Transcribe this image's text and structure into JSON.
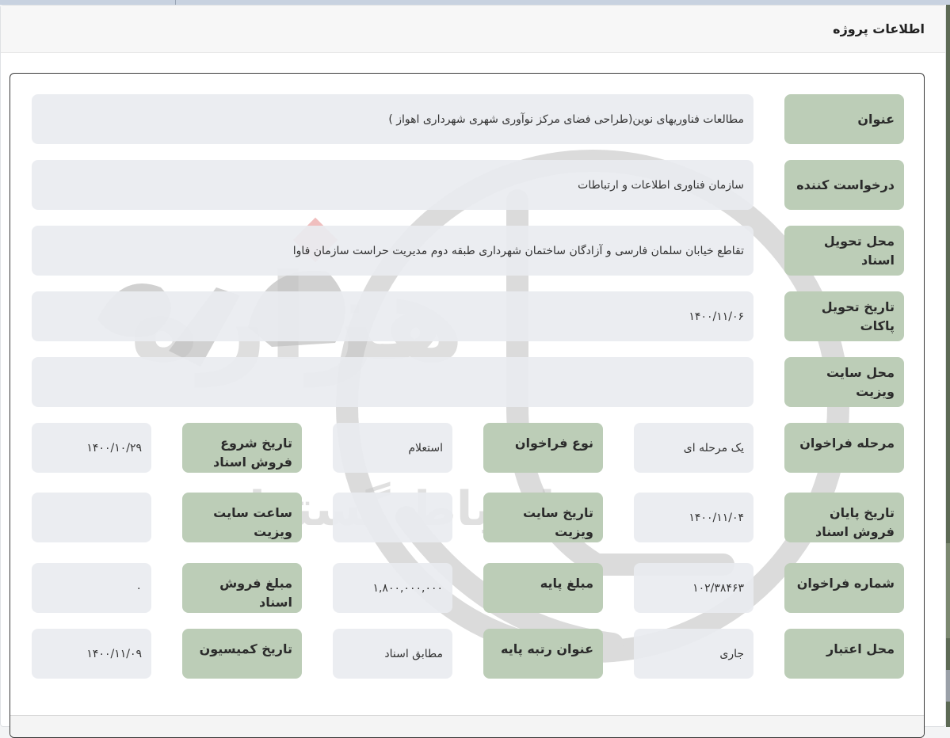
{
  "header": {
    "title": "اطلاعات پروژه"
  },
  "fields": {
    "title": {
      "label": "عنوان",
      "value": "مطالعات فناوریهای نوین(طراحی فضای مرکز نوآوری شهری شهرداری اهواز )"
    },
    "requester": {
      "label": "درخواست کننده",
      "value": "سازمان فناوری اطلاعات و ارتباطات"
    },
    "delivery_place": {
      "label": "محل تحویل اسناد",
      "value": "تقاطع خیابان سلمان فارسی و آزادگان ساختمان شهرداری طبقه دوم مدیریت حراست سازمان فاوا"
    },
    "packet_delivery_date": {
      "label": "تاریخ تحویل پاکات",
      "value": "۱۴۰۰/۱۱/۰۶"
    },
    "site_visit_place": {
      "label": "محل سایت ویزیت",
      "value": ""
    },
    "call_stage": {
      "label": "مرحله فراخوان",
      "value": "یک مرحله ای"
    },
    "call_type": {
      "label": "نوع فراخوان",
      "value": "استعلام"
    },
    "sale_start_date": {
      "label": "تاریخ شروع فروش اسناد",
      "value": "۱۴۰۰/۱۰/۲۹"
    },
    "sale_end_date": {
      "label": "تاریخ پایان فروش اسناد",
      "value": "۱۴۰۰/۱۱/۰۴"
    },
    "site_visit_date": {
      "label": "تاریخ سایت ویزیت",
      "value": ""
    },
    "site_visit_time": {
      "label": "ساعت سایت ویزیت",
      "value": ""
    },
    "call_number": {
      "label": "شماره فراخوان",
      "value": "۱۰۲/۳۸۴۶۳"
    },
    "base_amount": {
      "label": "مبلغ پایه",
      "value": "۱,۸۰۰,۰۰۰,۰۰۰"
    },
    "doc_sale_amount": {
      "label": "مبلغ فروش اسناد",
      "value": "۰"
    },
    "credit_place": {
      "label": "محل اعتبار",
      "value": "جاری"
    },
    "base_rank_title": {
      "label": "عنوان رتبه پایه",
      "value": "مطابق اسناد"
    },
    "commission_date": {
      "label": "تاریخ کمیسیون",
      "value": "۱۴۰۰/۱۱/۰۹"
    }
  },
  "watermark": {
    "main_text": "هزاره",
    "sub_text": "ارتباط گستران",
    "color": "#c9c9c9",
    "accent": "#e9a3a3"
  },
  "colors": {
    "label_bg": "#bccdb7",
    "value_bg": "#e9ecf0",
    "panel_border": "#3a3a3a"
  }
}
